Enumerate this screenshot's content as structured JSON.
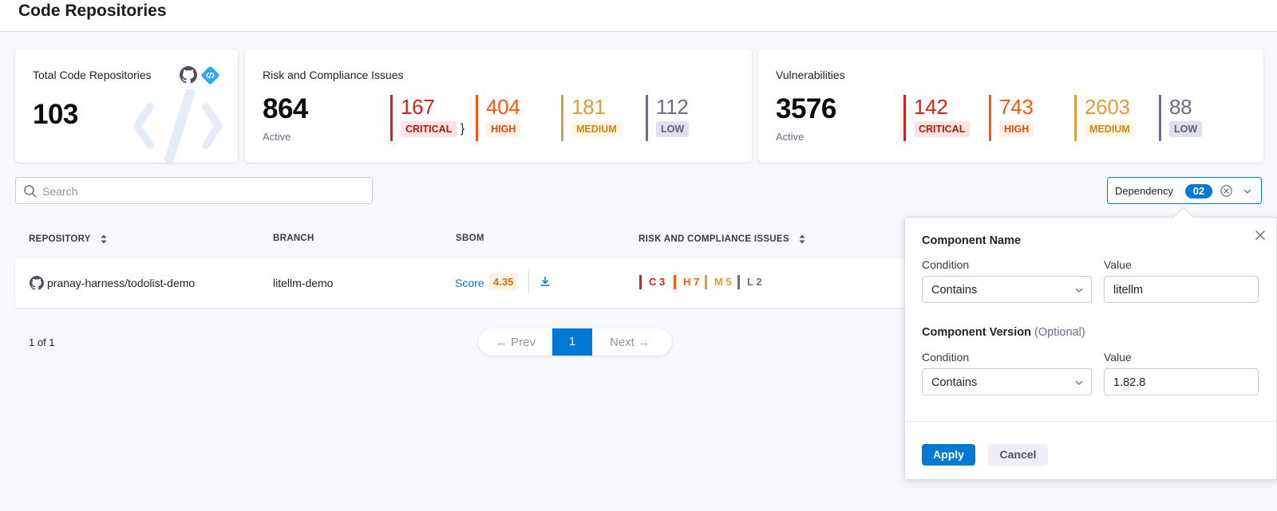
{
  "header": {
    "title": "Code Repositories"
  },
  "colors": {
    "accent": "#0278d5",
    "critical": "#cf2318",
    "high": "#ff5310",
    "medium": "#e29b36",
    "low": "#6b6d85"
  },
  "cards": {
    "repos": {
      "title": "Total Code Repositories",
      "count": "103",
      "icons": [
        "github-icon",
        "code-icon"
      ]
    },
    "risk": {
      "title": "Risk and Compliance Issues",
      "active_count": "864",
      "active_label": "Active",
      "severities": [
        {
          "count": "167",
          "label": "CRITICAL"
        },
        {
          "count": "404",
          "label": "HIGH"
        },
        {
          "count": "181",
          "label": "MEDIUM"
        },
        {
          "count": "112",
          "label": "LOW"
        }
      ]
    },
    "vulns": {
      "title": "Vulnerabilities",
      "active_count": "3576",
      "active_label": "Active",
      "severities": [
        {
          "count": "142",
          "label": "CRITICAL"
        },
        {
          "count": "743",
          "label": "HIGH"
        },
        {
          "count": "2603",
          "label": "MEDIUM"
        },
        {
          "count": "88",
          "label": "LOW"
        }
      ]
    }
  },
  "search": {
    "placeholder": "Search"
  },
  "filter": {
    "label": "Dependency",
    "count": "02"
  },
  "table": {
    "columns": [
      "REPOSITORY",
      "BRANCH",
      "SBOM",
      "RISK AND COMPLIANCE ISSUES"
    ],
    "rows": [
      {
        "repository": "pranay-harness/todolist-demo",
        "branch": "litellm-demo",
        "score_label": "Score",
        "score": "4.35",
        "issues": [
          "C 3",
          "H 7",
          "M 5",
          "L 2"
        ]
      }
    ]
  },
  "pagination": {
    "summary": "1 of 1",
    "prev": "Prev",
    "current": "1",
    "next": "Next"
  },
  "popover": {
    "component_name": {
      "title": "Component Name",
      "condition_label": "Condition",
      "condition": "Contains",
      "value_label": "Value",
      "value": "litellm"
    },
    "component_version": {
      "title": "Component Version",
      "optional": "(Optional)",
      "condition_label": "Condition",
      "condition": "Contains",
      "value_label": "Value",
      "value": "1.82.8"
    },
    "apply": "Apply",
    "cancel": "Cancel"
  }
}
